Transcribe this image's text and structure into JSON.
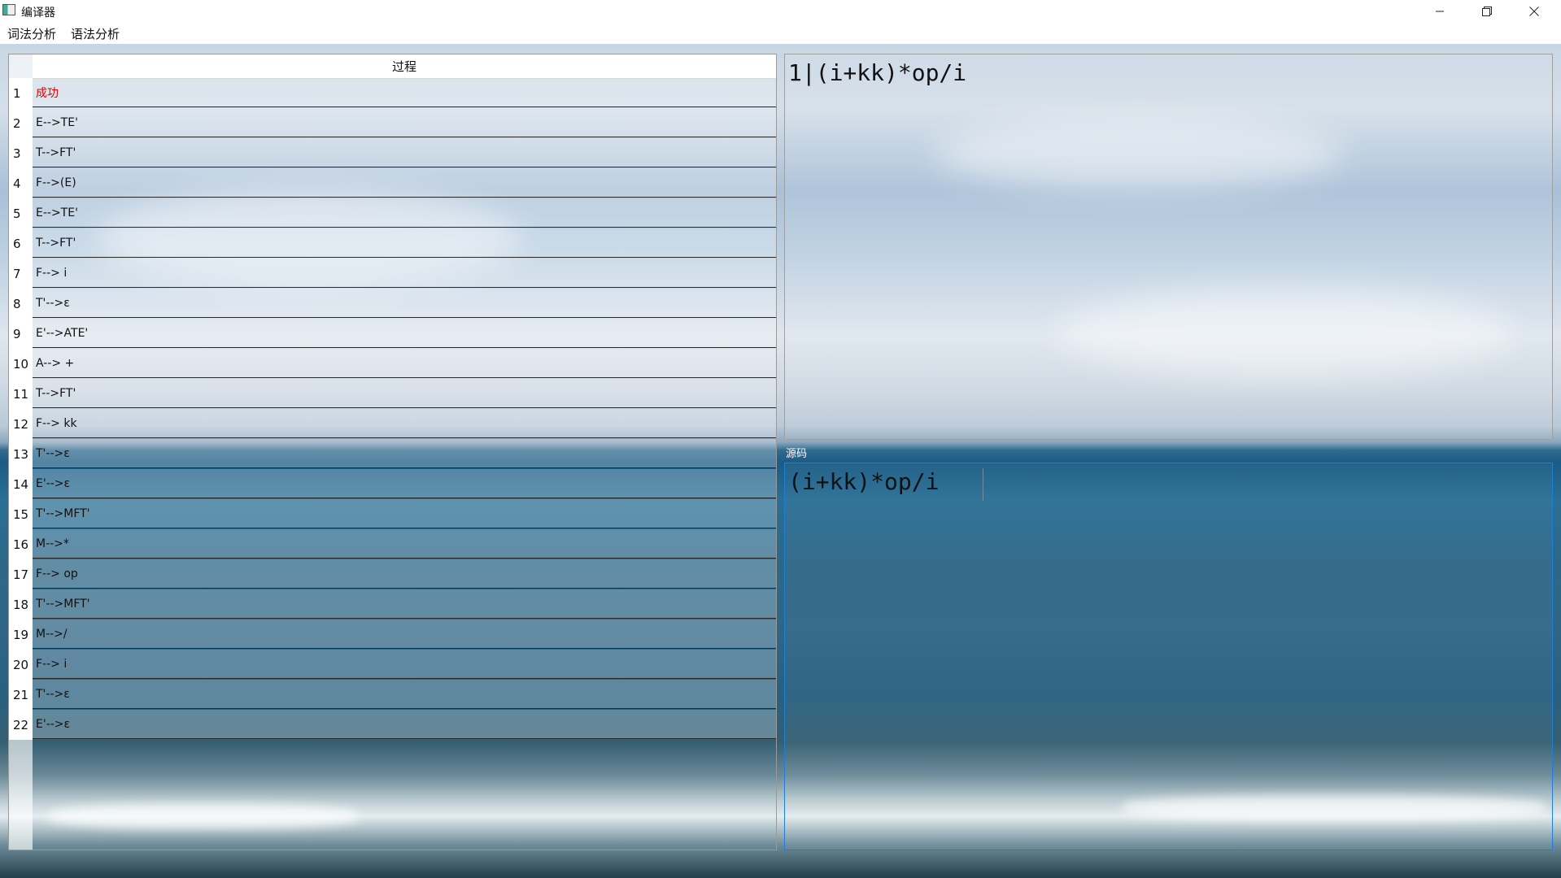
{
  "window": {
    "title": "编译器",
    "controls": [
      "minimize-icon",
      "restore-icon",
      "close-icon"
    ]
  },
  "menu": {
    "items": [
      {
        "label": "词法分析"
      },
      {
        "label": "语法分析"
      }
    ]
  },
  "process_table": {
    "column_header": "过程",
    "rows": [
      {
        "num": "1",
        "text": "成功",
        "status": "success"
      },
      {
        "num": "2",
        "text": "E-->TE'"
      },
      {
        "num": "3",
        "text": "T-->FT'"
      },
      {
        "num": "4",
        "text": "F-->(E)"
      },
      {
        "num": "5",
        "text": "E-->TE'"
      },
      {
        "num": "6",
        "text": "T-->FT'"
      },
      {
        "num": "7",
        "text": "F--> i"
      },
      {
        "num": "8",
        "text": "T'-->ε"
      },
      {
        "num": "9",
        "text": "E'-->ATE'"
      },
      {
        "num": "10",
        "text": "A--> +"
      },
      {
        "num": "11",
        "text": "T-->FT'"
      },
      {
        "num": "12",
        "text": "F--> kk"
      },
      {
        "num": "13",
        "text": "T'-->ε"
      },
      {
        "num": "14",
        "text": "E'-->ε"
      },
      {
        "num": "15",
        "text": "T'-->MFT'"
      },
      {
        "num": "16",
        "text": "M-->*"
      },
      {
        "num": "17",
        "text": "F--> op"
      },
      {
        "num": "18",
        "text": "T'-->MFT'"
      },
      {
        "num": "19",
        "text": "M-->/"
      },
      {
        "num": "20",
        "text": "F--> i"
      },
      {
        "num": "21",
        "text": "T'-->ε"
      },
      {
        "num": "22",
        "text": "E'-->ε"
      }
    ]
  },
  "output": {
    "text": "1|(i+kk)*op/i"
  },
  "source": {
    "label": "源码",
    "text": "(i+kk)*op/i"
  },
  "colors": {
    "success": "#e00000",
    "focus_border": "#1d7fd8"
  }
}
